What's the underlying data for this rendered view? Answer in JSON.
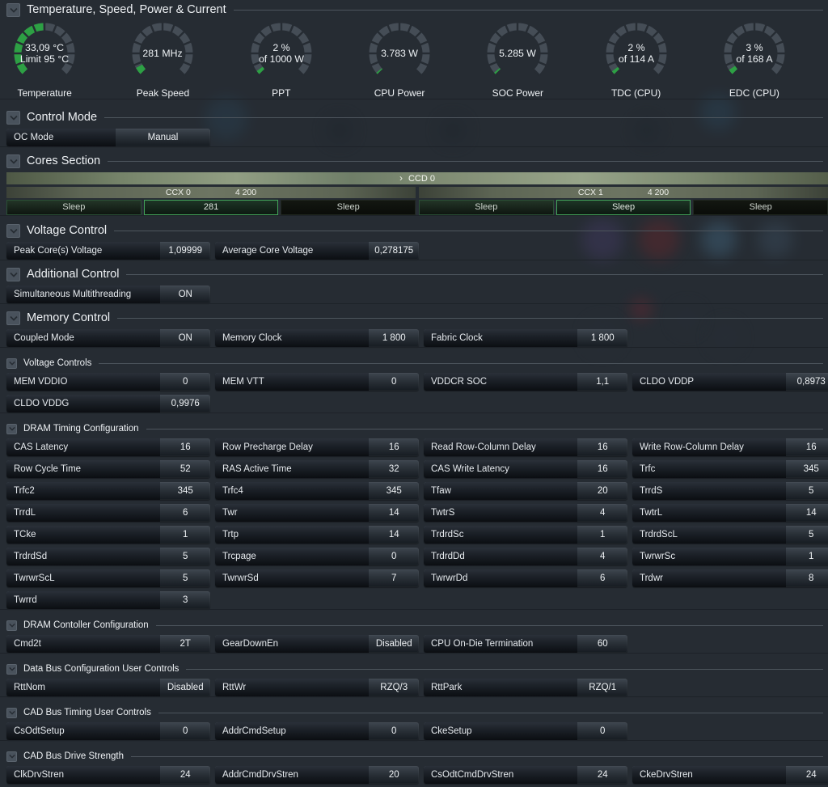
{
  "colors": {
    "background": "#262c33",
    "accent_green": "#2da044",
    "gauge_track": "#454d56",
    "header_rule": "#4d555d"
  },
  "sections": [
    {
      "id": "gauges",
      "kind": "gauges",
      "title": "Temperature, Speed, Power & Current",
      "gauges": [
        {
          "line1": "33,09 °C",
          "line2": "Limit 95 °C",
          "label": "Temperature",
          "fraction": 0.49
        },
        {
          "line1": "281  MHz",
          "line2": "",
          "label": "Peak Speed",
          "fraction": 0.06
        },
        {
          "line1": "2 %",
          "line2": "of 1000 W",
          "label": "PPT",
          "fraction": 0.035
        },
        {
          "line1": "3.783 W",
          "line2": "",
          "label": "CPU Power",
          "fraction": 0.018
        },
        {
          "line1": "5.285 W",
          "line2": "",
          "label": "SOC Power",
          "fraction": 0.02
        },
        {
          "line1": "2 %",
          "line2": "of 114 A",
          "label": "TDC (CPU)",
          "fraction": 0.032
        },
        {
          "line1": "3 %",
          "line2": "of 168 A",
          "label": "EDC (CPU)",
          "fraction": 0.045
        }
      ]
    },
    {
      "id": "control-mode",
      "kind": "fields",
      "title": "Control Mode",
      "fields": [
        {
          "label": "OC Mode",
          "value": "Manual"
        }
      ]
    },
    {
      "id": "cores",
      "kind": "cores",
      "title": "Cores Section",
      "ccd": {
        "chevron": "›",
        "label": "CCD 0"
      },
      "ccx": [
        {
          "name": "CCX 0",
          "clock": "4 200",
          "cells": [
            {
              "text": "Sleep",
              "state": "sleep"
            },
            {
              "text": "281",
              "state": "active"
            },
            {
              "text": "Sleep",
              "state": "off"
            }
          ]
        },
        {
          "name": "CCX 1",
          "clock": "4 200",
          "cells": [
            {
              "text": "Sleep",
              "state": "sleep"
            },
            {
              "text": "Sleep",
              "state": "active"
            },
            {
              "text": "Sleep",
              "state": "off"
            }
          ]
        }
      ]
    },
    {
      "id": "voltage-control",
      "kind": "fields",
      "title": "Voltage Control",
      "fields": [
        {
          "label": "Peak Core(s) Voltage",
          "value": "1,09999"
        },
        {
          "label": "Average Core Voltage",
          "value": "0,278175"
        }
      ]
    },
    {
      "id": "additional-control",
      "kind": "fields",
      "title": "Additional Control",
      "fields": [
        {
          "label": "Simultaneous Multithreading",
          "value": "ON"
        }
      ]
    },
    {
      "id": "memory-control",
      "kind": "fields",
      "title": "Memory Control",
      "fields": [
        {
          "label": "Coupled Mode",
          "value": "ON"
        },
        {
          "label": "Memory Clock",
          "value": "1 800"
        },
        {
          "label": "Fabric Clock",
          "value": "1 800"
        }
      ]
    },
    {
      "id": "voltage-controls",
      "kind": "fields",
      "small": true,
      "title": "Voltage Controls",
      "fields": [
        {
          "label": "MEM VDDIO",
          "value": "0"
        },
        {
          "label": "MEM VTT",
          "value": "0"
        },
        {
          "label": "VDDCR SOC",
          "value": "1,1"
        },
        {
          "label": "CLDO VDDP",
          "value": "0,8973"
        },
        {
          "label": "CLDO VDDG",
          "value": "0,9976"
        }
      ]
    },
    {
      "id": "dram-timing",
      "kind": "fields",
      "small": true,
      "title": "DRAM Timing Configuration",
      "fields": [
        {
          "label": "CAS Latency",
          "value": "16"
        },
        {
          "label": "Row Precharge Delay",
          "value": "16"
        },
        {
          "label": "Read Row-Column Delay",
          "value": "16"
        },
        {
          "label": "Write Row-Column Delay",
          "value": "16"
        },
        {
          "label": "Row Cycle Time",
          "value": "52"
        },
        {
          "label": "RAS Active Time",
          "value": "32"
        },
        {
          "label": "CAS Write Latency",
          "value": "16"
        },
        {
          "label": "Trfc",
          "value": "345"
        },
        {
          "label": "Trfc2",
          "value": "345"
        },
        {
          "label": "Trfc4",
          "value": "345"
        },
        {
          "label": "Tfaw",
          "value": "20"
        },
        {
          "label": "TrrdS",
          "value": "5"
        },
        {
          "label": "TrrdL",
          "value": "6"
        },
        {
          "label": "Twr",
          "value": "14"
        },
        {
          "label": "TwtrS",
          "value": "4"
        },
        {
          "label": "TwtrL",
          "value": "14"
        },
        {
          "label": "TCke",
          "value": "1"
        },
        {
          "label": "Trtp",
          "value": "14"
        },
        {
          "label": "TrdrdSc",
          "value": "1"
        },
        {
          "label": "TrdrdScL",
          "value": "5"
        },
        {
          "label": "TrdrdSd",
          "value": "5"
        },
        {
          "label": "Trcpage",
          "value": "0"
        },
        {
          "label": "TrdrdDd",
          "value": "4"
        },
        {
          "label": "TwrwrSc",
          "value": "1"
        },
        {
          "label": "TwrwrScL",
          "value": "5"
        },
        {
          "label": "TwrwrSd",
          "value": "7"
        },
        {
          "label": "TwrwrDd",
          "value": "6"
        },
        {
          "label": "Trdwr",
          "value": "8"
        },
        {
          "label": "Twrrd",
          "value": "3"
        }
      ]
    },
    {
      "id": "dram-controller",
      "kind": "fields",
      "small": true,
      "title": "DRAM Contoller Configuration",
      "fields": [
        {
          "label": "Cmd2t",
          "value": "2T"
        },
        {
          "label": "GearDownEn",
          "value": "Disabled"
        },
        {
          "label": "CPU On-Die Termination",
          "value": "60"
        }
      ]
    },
    {
      "id": "data-bus",
      "kind": "fields",
      "small": true,
      "title": "Data Bus Configuration User Controls",
      "fields": [
        {
          "label": "RttNom",
          "value": "Disabled"
        },
        {
          "label": "RttWr",
          "value": "RZQ/3"
        },
        {
          "label": "RttPark",
          "value": "RZQ/1"
        }
      ]
    },
    {
      "id": "cad-bus-timing",
      "kind": "fields",
      "small": true,
      "title": "CAD Bus Timing User Controls",
      "fields": [
        {
          "label": "CsOdtSetup",
          "value": "0"
        },
        {
          "label": "AddrCmdSetup",
          "value": "0"
        },
        {
          "label": "CkeSetup",
          "value": "0"
        }
      ]
    },
    {
      "id": "cad-bus-drive",
      "kind": "fields",
      "small": true,
      "title": "CAD Bus Drive Strength",
      "fields": [
        {
          "label": "ClkDrvStren",
          "value": "24"
        },
        {
          "label": "AddrCmdDrvStren",
          "value": "20"
        },
        {
          "label": "CsOdtCmdDrvStren",
          "value": "24"
        },
        {
          "label": "CkeDrvStren",
          "value": "24"
        }
      ]
    }
  ]
}
